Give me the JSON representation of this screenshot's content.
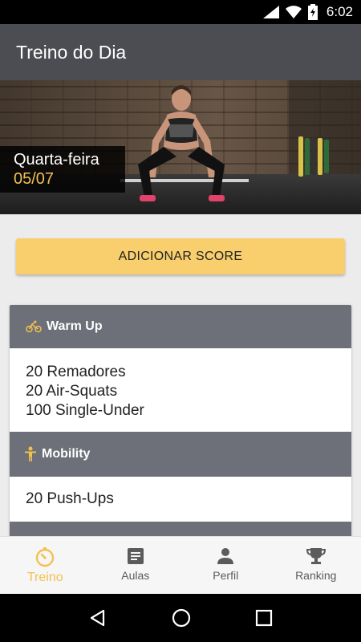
{
  "status_bar": {
    "time": "6:02"
  },
  "header": {
    "title": "Treino do Dia"
  },
  "hero": {
    "weekday": "Quarta-feira",
    "date": "05/07"
  },
  "actions": {
    "add_score_label": "ADICIONAR SCORE"
  },
  "workout": {
    "sections": [
      {
        "title": "Warm Up",
        "icon": "bicycle-icon",
        "lines": [
          "20 Remadores",
          "20 Air-Squats",
          "100 Single-Under"
        ]
      },
      {
        "title": "Mobility",
        "icon": "person-icon",
        "lines": [
          "20 Push-Ups"
        ]
      }
    ]
  },
  "bottom_nav": {
    "items": [
      {
        "label": "Treino",
        "icon": "stopwatch-icon",
        "active": true
      },
      {
        "label": "Aulas",
        "icon": "list-icon",
        "active": false
      },
      {
        "label": "Perfil",
        "icon": "profile-icon",
        "active": false
      },
      {
        "label": "Ranking",
        "icon": "trophy-icon",
        "active": false
      }
    ]
  },
  "colors": {
    "accent": "#f2c14e",
    "button": "#f8cf6c",
    "app_bar": "#4b4d52",
    "section_header": "#6e7079"
  }
}
